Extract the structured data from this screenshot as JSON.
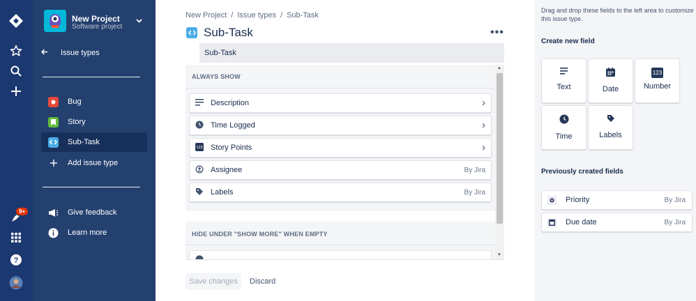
{
  "project": {
    "name": "New Project",
    "type": "Software project"
  },
  "sidebar": {
    "back_label": "Issue types",
    "items": [
      {
        "label": "Bug",
        "icon": "bug-icon",
        "color": "#e5493a"
      },
      {
        "label": "Story",
        "icon": "story-icon",
        "color": "#63ba3c"
      },
      {
        "label": "Sub-Task",
        "icon": "subtask-icon",
        "color": "#4bade8"
      },
      {
        "label": "Add issue type",
        "icon": "plus-icon"
      }
    ],
    "footer": [
      {
        "label": "Give feedback",
        "icon": "megaphone-icon"
      },
      {
        "label": "Learn more",
        "icon": "info-icon"
      }
    ]
  },
  "rail": {
    "notifications_badge": "9+"
  },
  "breadcrumb": [
    "New Project",
    "/",
    "Issue types",
    "/",
    "Sub-Task"
  ],
  "page": {
    "title": "Sub-Task",
    "description": "Sub-Task"
  },
  "sections": {
    "always_show": "ALWAYS SHOW",
    "hide_under": "HIDE UNDER \"SHOW MORE\" WHEN EMPTY"
  },
  "fields": [
    {
      "label": "Description",
      "icon": "text-icon",
      "right": "›"
    },
    {
      "label": "Time Logged",
      "icon": "clock-icon",
      "right": "›"
    },
    {
      "label": "Story Points",
      "icon": "number-icon",
      "right": "›"
    },
    {
      "label": "Assignee",
      "icon": "user-icon",
      "right": "By Jira"
    },
    {
      "label": "Labels",
      "icon": "tag-icon",
      "right": "By Jira"
    }
  ],
  "actions": {
    "save": "Save changes",
    "discard": "Discard"
  },
  "right_panel": {
    "hint": "Drag and drop these fields to the left area to customize this issue type.",
    "create_title": "Create new field",
    "new_fields": [
      {
        "label": "Text",
        "icon": "text-icon"
      },
      {
        "label": "Date",
        "icon": "calendar-icon"
      },
      {
        "label": "Number",
        "icon": "number-icon",
        "icon_text": "123"
      },
      {
        "label": "Time",
        "icon": "clock-icon"
      },
      {
        "label": "Labels",
        "icon": "tag-icon"
      }
    ],
    "previous_title": "Previously created fields",
    "previous_fields": [
      {
        "label": "Priority",
        "icon": "priority-icon",
        "right": "By Jira"
      },
      {
        "label": "Due date",
        "icon": "calendar-icon",
        "right": "By Jira"
      }
    ]
  }
}
